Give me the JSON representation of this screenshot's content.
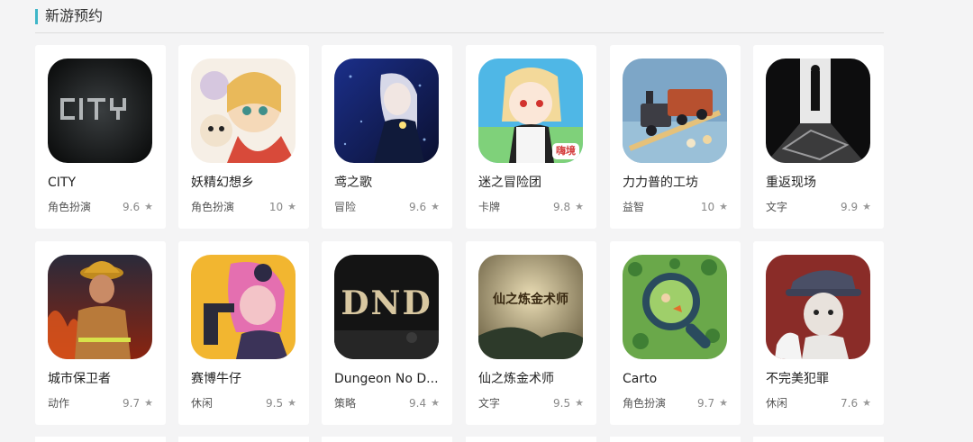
{
  "section": {
    "title": "新游预约"
  },
  "games": [
    {
      "name": "CITY",
      "genre": "角色扮演",
      "rating": "9.6",
      "art": "city"
    },
    {
      "name": "妖精幻想乡",
      "genre": "角色扮演",
      "rating": "10",
      "art": "fairy"
    },
    {
      "name": "鸢之歌",
      "genre": "冒险",
      "rating": "9.6",
      "art": "kite"
    },
    {
      "name": "迷之冒险团",
      "genre": "卡牌",
      "rating": "9.8",
      "art": "adventure",
      "badge": "嗨境"
    },
    {
      "name": "力力普的工坊",
      "genre": "益智",
      "rating": "10",
      "art": "train"
    },
    {
      "name": "重返现场",
      "genre": "文字",
      "rating": "9.9",
      "art": "scene"
    },
    {
      "name": "城市保卫者",
      "genre": "动作",
      "rating": "9.7",
      "art": "firefighter"
    },
    {
      "name": "赛博牛仔",
      "genre": "休闲",
      "rating": "9.5",
      "art": "cyber"
    },
    {
      "name": "Dungeon No D...",
      "genre": "策略",
      "rating": "9.4",
      "art": "dungeon",
      "logo_text": "DND"
    },
    {
      "name": "仙之炼金术师",
      "genre": "文字",
      "rating": "9.5",
      "art": "alchemist",
      "logo_text": "仙之炼金术师"
    },
    {
      "name": "Carto",
      "genre": "角色扮演",
      "rating": "9.7",
      "art": "carto"
    },
    {
      "name": "不完美犯罪",
      "genre": "休闲",
      "rating": "7.6",
      "art": "crime"
    }
  ],
  "icons": {
    "rating": "star-icon"
  },
  "colors": {
    "accent": "#3fb6c8",
    "card_bg": "#ffffff",
    "page_bg": "#f4f4f5"
  }
}
